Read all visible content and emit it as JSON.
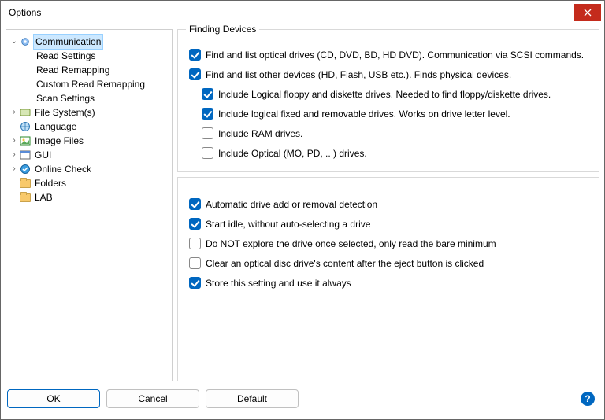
{
  "window": {
    "title": "Options"
  },
  "tree": {
    "selected": "Communication",
    "items": [
      {
        "id": "communication",
        "label": "Communication",
        "expandable": true,
        "expanded": true,
        "icon": "gear",
        "selected": true,
        "children": [
          {
            "id": "read-settings",
            "label": "Read Settings"
          },
          {
            "id": "read-remapping",
            "label": "Read Remapping"
          },
          {
            "id": "custom-read-remapping",
            "label": "Custom Read Remapping"
          },
          {
            "id": "scan-settings",
            "label": "Scan Settings"
          }
        ]
      },
      {
        "id": "file-systems",
        "label": "File System(s)",
        "expandable": true,
        "expanded": false,
        "icon": "disk"
      },
      {
        "id": "language",
        "label": "Language",
        "icon": "globe"
      },
      {
        "id": "image-files",
        "label": "Image Files",
        "expandable": true,
        "expanded": false,
        "icon": "picture"
      },
      {
        "id": "gui",
        "label": "GUI",
        "expandable": true,
        "expanded": false,
        "icon": "window"
      },
      {
        "id": "online-check",
        "label": "Online Check",
        "expandable": true,
        "expanded": false,
        "icon": "globe2"
      },
      {
        "id": "folders",
        "label": "Folders",
        "icon": "folder"
      },
      {
        "id": "lab",
        "label": "LAB",
        "icon": "folder"
      }
    ]
  },
  "group1": {
    "legend": "Finding Devices",
    "opt1": {
      "label": "Find and list optical drives (CD, DVD, BD, HD DVD).  Communication via SCSI commands.",
      "checked": true
    },
    "opt2": {
      "label": "Find and list other devices (HD, Flash, USB etc.).  Finds physical devices.",
      "checked": true
    },
    "opt3": {
      "label": "Include Logical floppy and diskette drives.  Needed to find floppy/diskette drives.",
      "checked": true
    },
    "opt4": {
      "label": "Include logical fixed and removable drives.  Works on drive letter level.",
      "checked": true
    },
    "opt5": {
      "label": "Include RAM drives.",
      "checked": false
    },
    "opt6": {
      "label": "Include Optical (MO, PD, .. ) drives.",
      "checked": false
    }
  },
  "group2": {
    "opt1": {
      "label": "Automatic drive add or removal detection",
      "checked": true
    },
    "opt2": {
      "label": "Start idle, without auto-selecting a drive",
      "checked": true
    },
    "opt3": {
      "label": "Do NOT explore the drive once selected, only read the bare minimum",
      "checked": false
    },
    "opt4": {
      "label": "Clear an optical disc drive's content after the eject button is clicked",
      "checked": false
    },
    "opt5": {
      "label": "Store this setting and use it always",
      "checked": true
    }
  },
  "buttons": {
    "ok": "OK",
    "cancel": "Cancel",
    "default": "Default"
  }
}
